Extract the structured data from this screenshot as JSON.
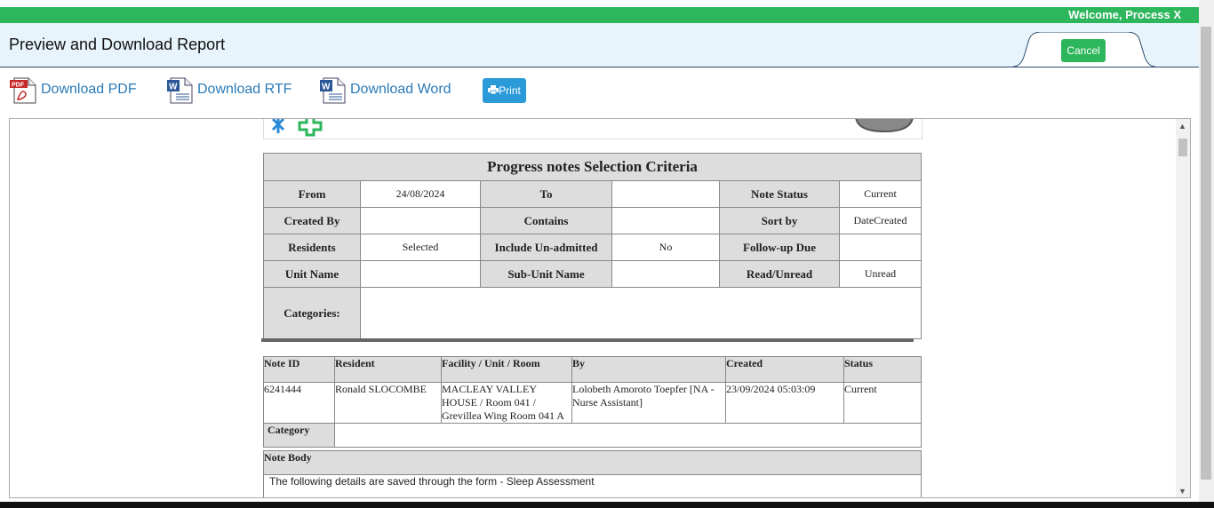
{
  "topbar": {
    "welcome": "Welcome, Process X"
  },
  "header": {
    "title": "Preview and Download Report",
    "cancel_label": "Cancel"
  },
  "toolbar": {
    "pdf_label": "Download PDF",
    "rtf_label": "Download RTF",
    "word_label": "Download Word",
    "print_label": "Print"
  },
  "criteria": {
    "title": "Progress notes Selection Criteria",
    "from_label": "From",
    "from_value": "24/08/2024",
    "to_label": "To",
    "to_value": "",
    "note_status_label": "Note Status",
    "note_status_value": "Current",
    "created_by_label": "Created By",
    "created_by_value": "",
    "contains_label": "Contains",
    "contains_value": "",
    "sort_by_label": "Sort by",
    "sort_by_value": "DateCreated",
    "residents_label": "Residents",
    "residents_value": "Selected",
    "include_unadmitted_label": "Include Un-admitted",
    "include_unadmitted_value": "No",
    "followup_label": "Follow-up Due",
    "followup_value": "",
    "unit_name_label": "Unit Name",
    "unit_name_value": "",
    "subunit_label": "Sub-Unit Name",
    "subunit_value": "",
    "read_unread_label": "Read/Unread",
    "read_unread_value": "Unread",
    "categories_label": "Categories:",
    "categories_value": ""
  },
  "notes": {
    "headers": [
      "Note ID",
      "Resident",
      "Facility / Unit / Room",
      "By",
      "Created",
      "Status"
    ],
    "row": {
      "note_id": "6241444",
      "resident": "Ronald SLOCOMBE",
      "facility": "MACLEAY VALLEY HOUSE / Room 041 / Grevillea Wing Room 041 A",
      "by": "Lolobeth Amoroto Toepfer [NA - Nurse Assistant]",
      "created": "23/09/2024 05:03:09",
      "status": "Current"
    },
    "category_label": "Category",
    "category_value": "",
    "note_body_label": "Note Body",
    "note_body_text": "The following details are saved through the form - Sleep Assessment"
  },
  "colors": {
    "accent_green": "#2eb65c",
    "link_blue": "#2a7ab8",
    "print_blue": "#2a9ad8"
  }
}
